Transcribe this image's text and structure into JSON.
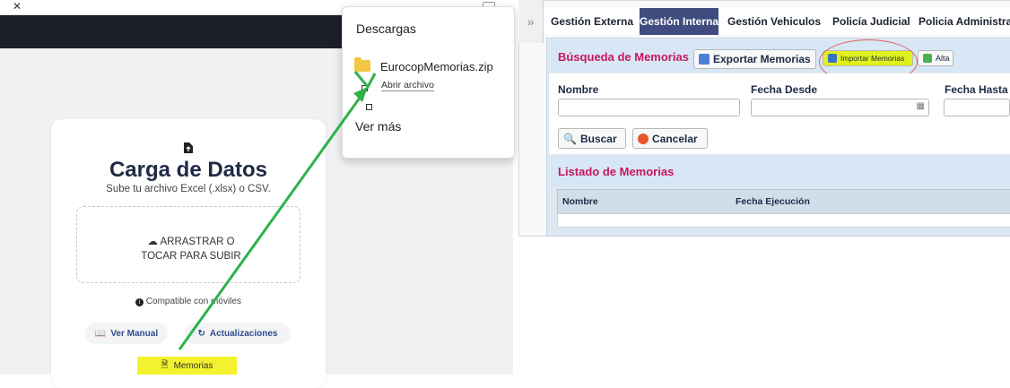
{
  "left_panel": {
    "carga_title": "Carga de Datos",
    "carga_subtitle": "Sube tu archivo Excel (.xlsx) o CSV.",
    "dropzone_text": "ARRASTRAR O TOCAR PARA SUBIR",
    "compat_text": "Compatible con móviles",
    "manual_label": "Ver Manual",
    "updates_label": "Actualizaciones",
    "memorias_label": "Memorias"
  },
  "downloads": {
    "title": "Descargas",
    "file_name": "EurocopMemorias.zip",
    "open_label": "Abrir archivo",
    "more_label": "Ver más"
  },
  "right_panel": {
    "tabs": [
      {
        "label": "Gestión Externa"
      },
      {
        "label": "Gestión Interna"
      },
      {
        "label": "Gestión Vehiculos"
      },
      {
        "label": "Policía Judicial"
      },
      {
        "label": "Policia Administra"
      }
    ],
    "active_tab": "Gestión Interna",
    "busqueda_title": "Búsqueda de Memorias",
    "exportar_label": "Exportar Memorias",
    "importar_label": "Importar Memorias",
    "alta_label": "Alta",
    "nombre_label": "Nombre",
    "fecha_desde_label": "Fecha Desde",
    "fecha_hasta_label": "Fecha Hasta",
    "buscar_label": "Buscar",
    "cancelar_label": "Cancelar",
    "listado_title": "Listado de Memorias",
    "columns": [
      "Nombre",
      "Fecha Ejecución"
    ]
  },
  "colors": {
    "highlight_yellow": "#f4f22e",
    "accent_magenta": "#c8175c",
    "active_tab_bg": "#404b7e",
    "arrow_green": "#2eb24a",
    "circle_red": "#e06060"
  }
}
